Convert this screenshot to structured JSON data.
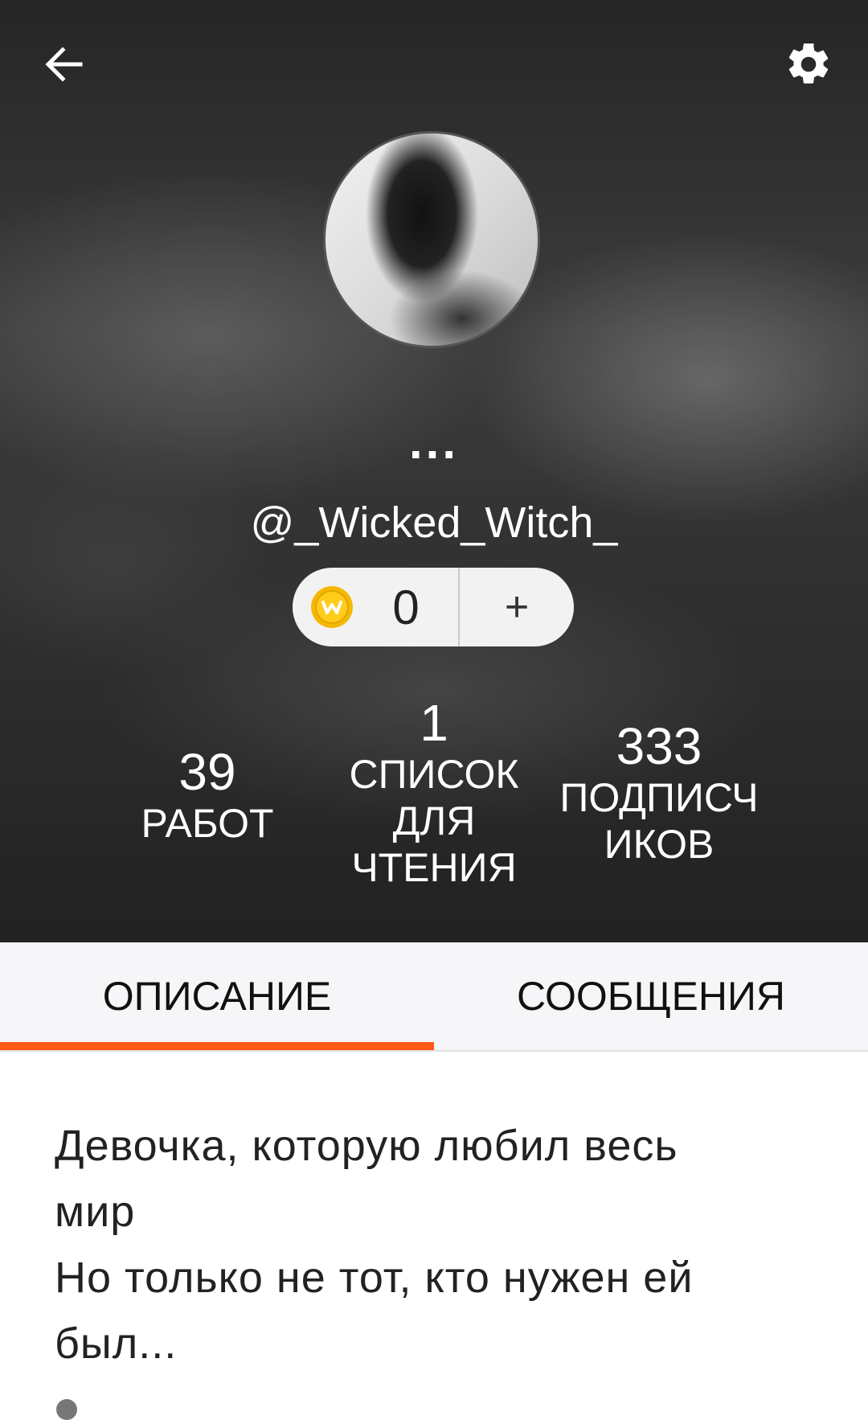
{
  "header": {
    "display_name": "...",
    "username": "@_Wicked_Witch_",
    "back_icon": "arrow-left-icon",
    "settings_icon": "gear-icon"
  },
  "coins": {
    "value": "0",
    "add_label": "+",
    "coin_icon": "wattpad-coin-icon",
    "coin_color": "#f5b800"
  },
  "stats": {
    "works": {
      "value": "39",
      "label": "РАБОТ"
    },
    "reading_lists": {
      "value": "1",
      "label_lines": [
        "СПИСОК",
        "ДЛЯ",
        "ЧТЕНИЯ"
      ]
    },
    "followers": {
      "value": "333",
      "label_lines": [
        "ПОДПИСЧ",
        "ИКОВ"
      ]
    }
  },
  "tabs": [
    {
      "label": "ОПИСАНИЕ",
      "active": true
    },
    {
      "label": "СООБЩЕНИЯ",
      "active": false
    }
  ],
  "accent_color": "#ff5a14",
  "about": {
    "text": "Девочка, которую любил весь\nмир\nНо только не тот, кто нужен ей\nбыл..."
  }
}
